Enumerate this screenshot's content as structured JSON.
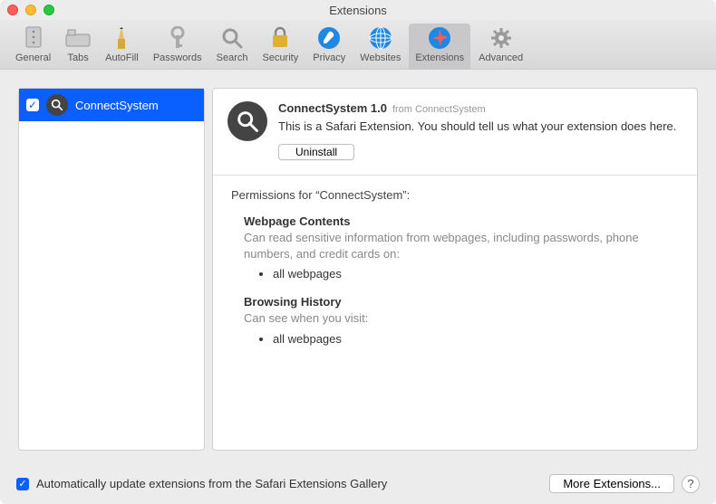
{
  "window": {
    "title": "Extensions"
  },
  "toolbar": {
    "items": [
      {
        "label": "General"
      },
      {
        "label": "Tabs"
      },
      {
        "label": "AutoFill"
      },
      {
        "label": "Passwords"
      },
      {
        "label": "Search"
      },
      {
        "label": "Security"
      },
      {
        "label": "Privacy"
      },
      {
        "label": "Websites"
      },
      {
        "label": "Extensions"
      },
      {
        "label": "Advanced"
      }
    ]
  },
  "sidebar": {
    "items": [
      {
        "label": "ConnectSystem",
        "checked": true
      }
    ]
  },
  "detail": {
    "name_version": "ConnectSystem 1.0",
    "from_label": "from ConnectSystem",
    "description": "This is a Safari Extension. You should tell us what your extension does here.",
    "uninstall_label": "Uninstall"
  },
  "permissions": {
    "title": "Permissions for “ConnectSystem”:",
    "blocks": [
      {
        "heading": "Webpage Contents",
        "desc": "Can read sensitive information from webpages, including passwords, phone numbers, and credit cards on:",
        "items": [
          "all webpages"
        ]
      },
      {
        "heading": "Browsing History",
        "desc": "Can see when you visit:",
        "items": [
          "all webpages"
        ]
      }
    ]
  },
  "footer": {
    "auto_update_label": "Automatically update extensions from the Safari Extensions Gallery",
    "more_label": "More Extensions...",
    "help_label": "?"
  },
  "colors": {
    "selection": "#0a60ff"
  }
}
